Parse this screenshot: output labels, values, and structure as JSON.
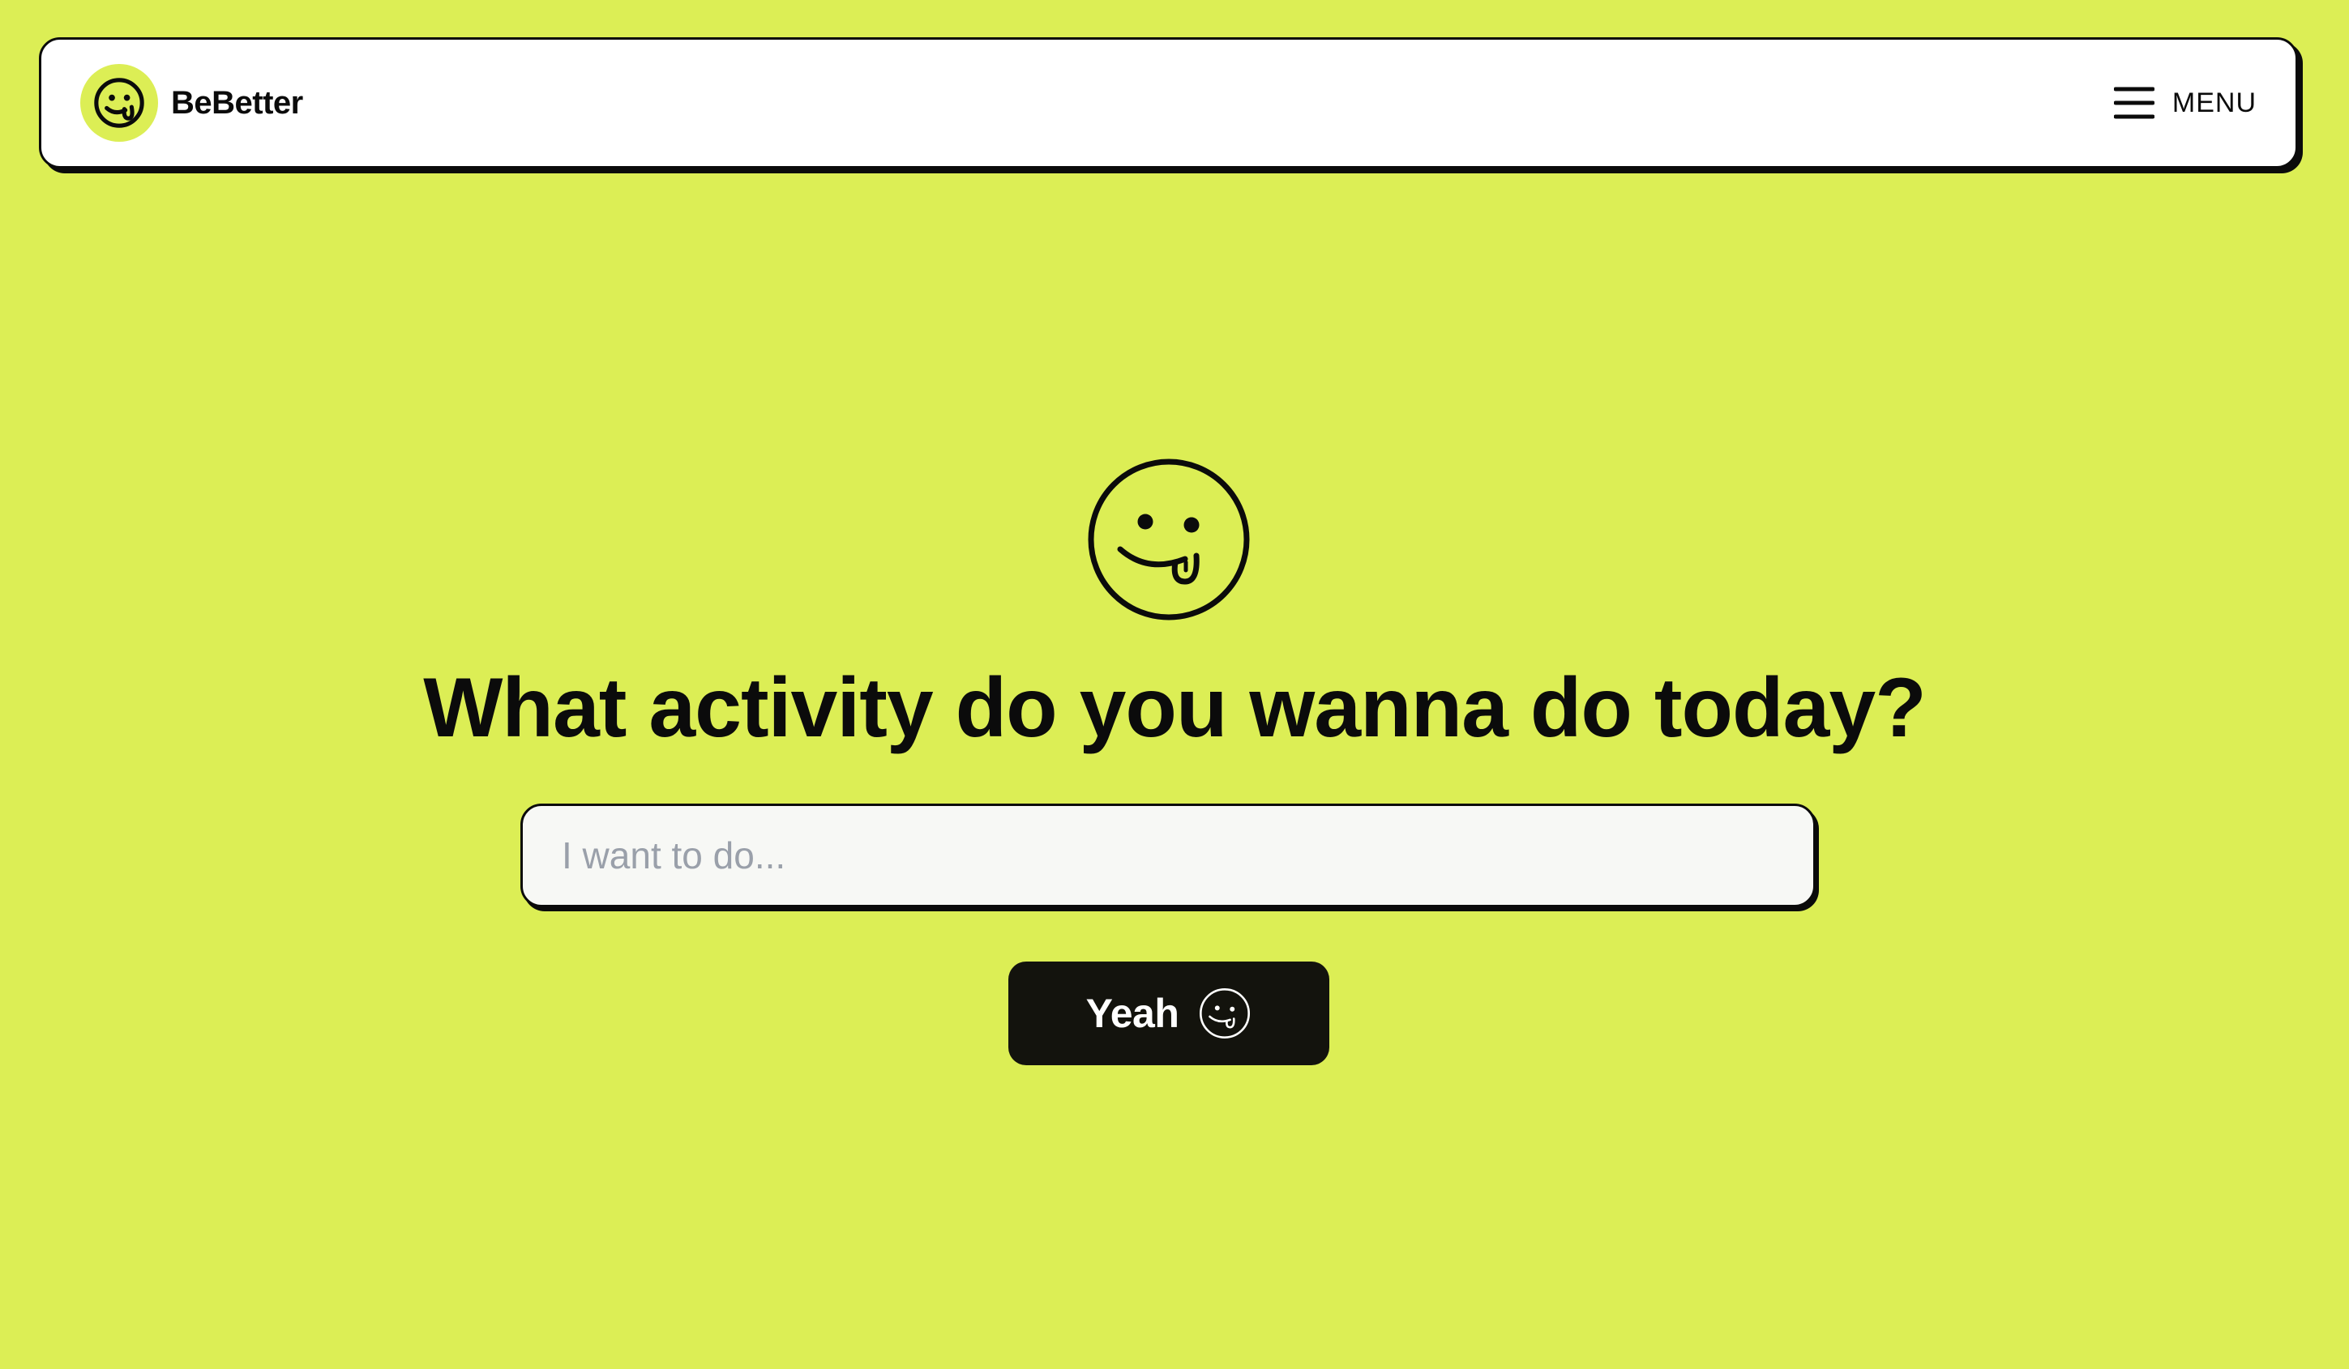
{
  "header": {
    "brand_name": "BeBetter",
    "logo_icon": "tongue-smiley-icon",
    "menu_icon": "hamburger-icon",
    "menu_label": "MENU"
  },
  "hero": {
    "icon": "tongue-smiley-icon",
    "headline": "What activity do you wanna do today?",
    "input_placeholder": "I want to do...",
    "input_value": "",
    "submit_label": "Yeah",
    "submit_icon": "tongue-smiley-icon"
  },
  "colors": {
    "page_background": "#dcee55",
    "surface": "#ffffff",
    "ink": "#0b0b0b",
    "input_background": "#f7f8f5",
    "placeholder": "#9aa0aa",
    "button_background": "#13130d",
    "button_text": "#ffffff"
  }
}
